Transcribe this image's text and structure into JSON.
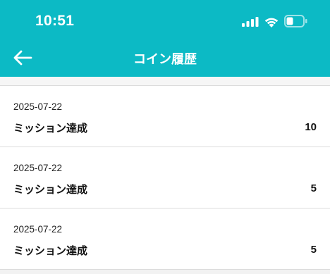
{
  "status_bar": {
    "time": "10:51",
    "signal_icon": "cellular-signal-icon",
    "wifi_icon": "wifi-icon",
    "battery_icon": "battery-icon",
    "battery_level": 0.35
  },
  "header": {
    "back_icon": "back-arrow-icon",
    "title": "コイン履歴",
    "background_color": "#0cbac5"
  },
  "history": [
    {
      "date": "2025-07-22",
      "label": "ミッション達成",
      "amount": "10"
    },
    {
      "date": "2025-07-22",
      "label": "ミッション達成",
      "amount": "5"
    },
    {
      "date": "2025-07-22",
      "label": "ミッション達成",
      "amount": "5"
    }
  ]
}
